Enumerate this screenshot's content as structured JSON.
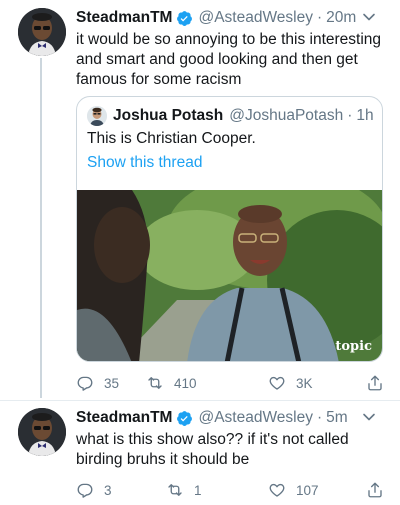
{
  "tweet1": {
    "name": "SteadmanTM",
    "handle": "@AsteadWesley",
    "time": "20m",
    "text": "it would be so annoying to be this interesting and smart and good looking and then get famous for some racism",
    "quote": {
      "name": "Joshua Potash",
      "handle": "@JoshuaPotash",
      "time": "1h",
      "text": "This is Christian Cooper.",
      "link": "Show this thread",
      "watermark": "topic"
    },
    "actions": {
      "replies": "35",
      "retweets": "410",
      "likes": "3K"
    }
  },
  "tweet2": {
    "name": "SteadmanTM",
    "handle": "@AsteadWesley",
    "time": "5m",
    "text": "what is this show also?? if it's not called birding bruhs it should be",
    "actions": {
      "replies": "3",
      "retweets": "1",
      "likes": "107"
    }
  },
  "icons": {
    "verified": "verified-badge-icon",
    "caret": "chevron-down-icon",
    "reply": "reply-icon",
    "retweet": "retweet-icon",
    "like": "heart-icon",
    "share": "share-icon"
  },
  "colors": {
    "accent": "#1da1f2",
    "secondary": "#657786",
    "border": "#ccd6dd",
    "text": "#14171a"
  }
}
